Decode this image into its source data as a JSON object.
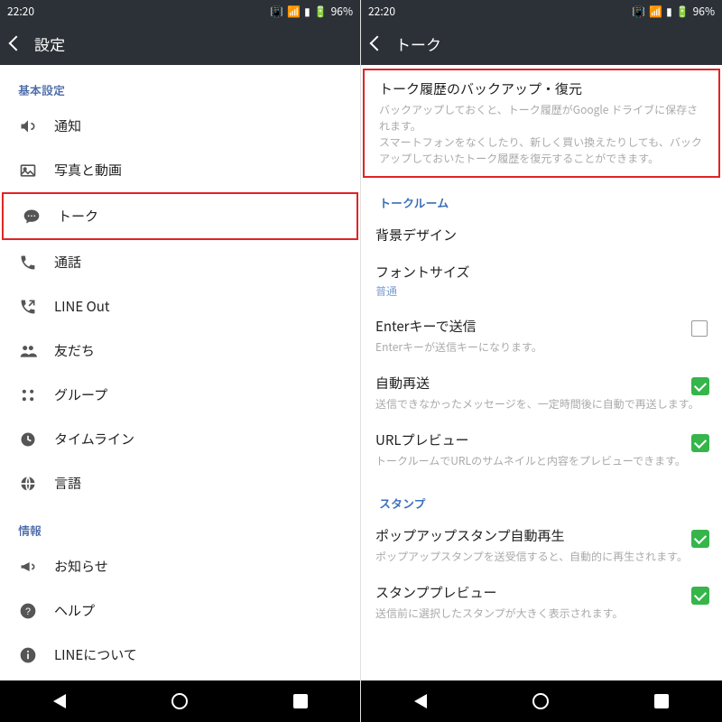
{
  "status": {
    "time": "22:20",
    "battery": "96%"
  },
  "left": {
    "header_title": "設定",
    "basic_label": "基本設定",
    "info_label": "情報",
    "items": [
      {
        "icon": "volume",
        "label": "通知"
      },
      {
        "icon": "picture",
        "label": "写真と動画"
      },
      {
        "icon": "chat",
        "label": "トーク",
        "hl": true
      },
      {
        "icon": "phone",
        "label": "通話"
      },
      {
        "icon": "phone-out",
        "label": "LINE Out"
      },
      {
        "icon": "friends",
        "label": "友だち"
      },
      {
        "icon": "grid",
        "label": "グループ"
      },
      {
        "icon": "clock",
        "label": "タイムライン"
      },
      {
        "icon": "globe",
        "label": "言語"
      }
    ],
    "info_items": [
      {
        "icon": "megaphone",
        "label": "お知らせ"
      },
      {
        "icon": "help",
        "label": "ヘルプ"
      },
      {
        "icon": "info",
        "label": "LINEについて"
      }
    ]
  },
  "right": {
    "header_title": "トーク",
    "backup": {
      "title": "トーク履歴のバックアップ・復元",
      "desc": "バックアップしておくと、トーク履歴がGoogle ドライブに保存されます。\nスマートフォンをなくしたり、新しく買い換えたりしても、バックアップしておいたトーク履歴を復元することができます。"
    },
    "room_label": "トークルーム",
    "bg": {
      "title": "背景デザイン"
    },
    "font": {
      "title": "フォントサイズ",
      "sub": "普通"
    },
    "enter": {
      "title": "Enterキーで送信",
      "desc": "Enterキーが送信キーになります。"
    },
    "resend": {
      "title": "自動再送",
      "desc": "送信できなかったメッセージを、一定時間後に自動で再送します。"
    },
    "urlprev": {
      "title": "URLプレビュー",
      "desc": "トークルームでURLのサムネイルと内容をプレビューできます。"
    },
    "stamp_label": "スタンプ",
    "popup": {
      "title": "ポップアップスタンプ自動再生",
      "desc": "ポップアップスタンプを送受信すると、自動的に再生されます。"
    },
    "preview": {
      "title": "スタンププレビュー",
      "desc": "送信前に選択したスタンプが大きく表示されます。"
    }
  }
}
